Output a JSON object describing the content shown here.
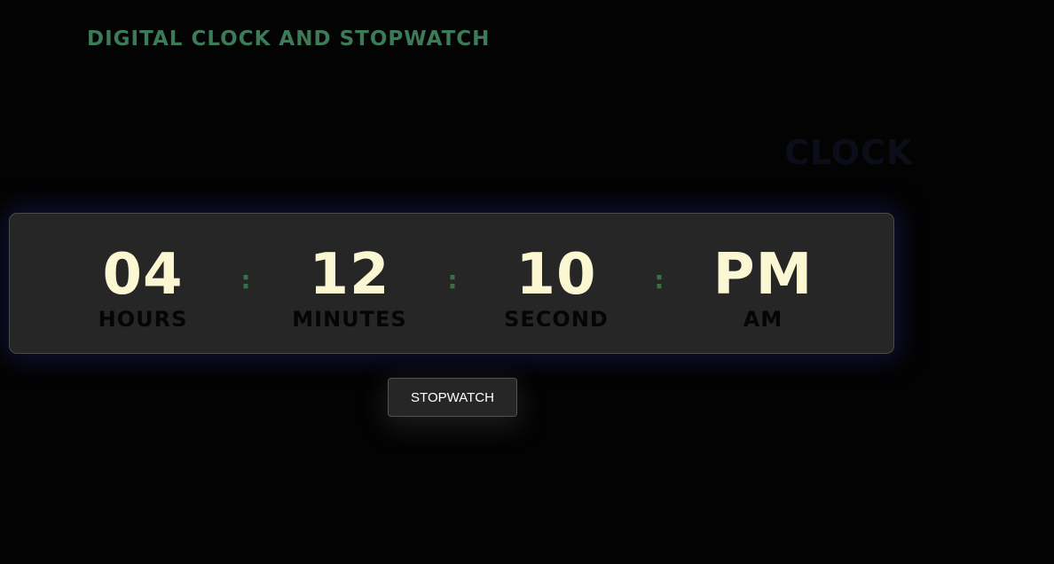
{
  "page": {
    "title": "DIGITAL CLOCK AND STOPWATCH",
    "section_title": "CLOCK"
  },
  "clock": {
    "hours": {
      "value": "04",
      "label": "HOURS"
    },
    "minutes": {
      "value": "12",
      "label": "MINUTES"
    },
    "seconds": {
      "value": "10",
      "label": "SECOND"
    },
    "period": {
      "value": "PM",
      "label": "AM"
    },
    "separator": ":"
  },
  "actions": {
    "stopwatch_label": "STOPWATCH"
  },
  "colors": {
    "background": "#030303",
    "title": "#3d7a58",
    "panel": "#262626",
    "digits": "#fbf7d2",
    "separator": "#3d6e4c",
    "panel_glow": "#1c1e5f"
  }
}
